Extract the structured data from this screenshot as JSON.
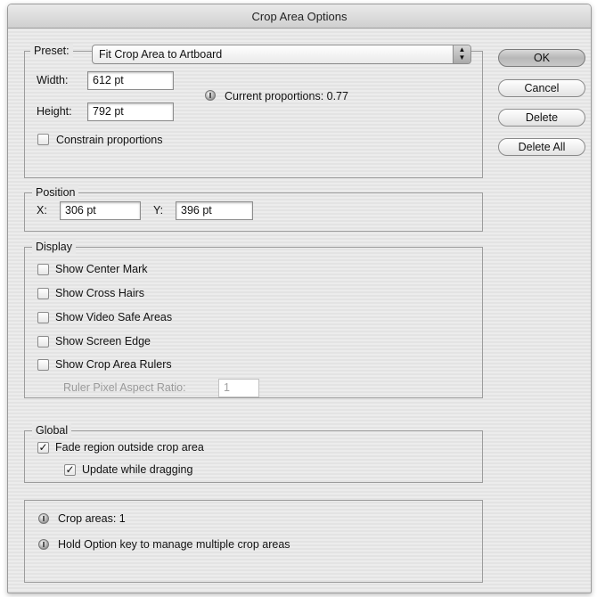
{
  "dialog": {
    "title": "Crop Area Options"
  },
  "preset": {
    "legend_label": "Preset:",
    "selected": "Fit Crop Area to Artboard",
    "width_label": "Width:",
    "width_value": "612 pt",
    "height_label": "Height:",
    "height_value": "792 pt",
    "proportions_text": "Current proportions: 0.77",
    "constrain_label": "Constrain proportions",
    "constrain_checked": false
  },
  "position": {
    "legend": "Position",
    "x_label": "X:",
    "x_value": "306 pt",
    "y_label": "Y:",
    "y_value": "396 pt"
  },
  "display": {
    "legend": "Display",
    "options": [
      {
        "label": "Show Center Mark",
        "checked": false
      },
      {
        "label": "Show Cross Hairs",
        "checked": false
      },
      {
        "label": "Show Video Safe Areas",
        "checked": false
      },
      {
        "label": "Show Screen Edge",
        "checked": false
      },
      {
        "label": "Show Crop Area Rulers",
        "checked": false
      }
    ],
    "ruler_ratio_label": "Ruler Pixel Aspect Ratio:",
    "ruler_ratio_value": "1"
  },
  "global": {
    "legend": "Global",
    "fade_label": "Fade region outside crop area",
    "fade_checked": true,
    "update_label": "Update while dragging",
    "update_checked": true
  },
  "info": {
    "crop_areas": "Crop areas: 1",
    "hint": "Hold Option key to manage multiple crop areas"
  },
  "buttons": {
    "ok": "OK",
    "cancel": "Cancel",
    "delete": "Delete",
    "delete_all": "Delete All"
  },
  "icons": {
    "info": "info-icon",
    "dropdown": "stepper-arrows-icon",
    "check": "checkmark-icon"
  }
}
